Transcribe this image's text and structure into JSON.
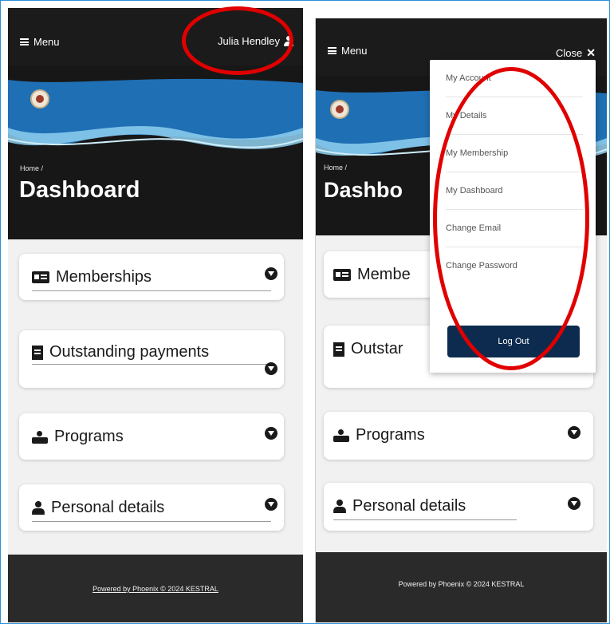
{
  "left_screen": {
    "menu_label": "Menu",
    "user_name": "Julia Hendley",
    "breadcrumb": "Home  /",
    "page_title": "Dashboard",
    "cards": [
      {
        "label": "Memberships",
        "icon": "id-card-icon"
      },
      {
        "label": "Outstanding payments",
        "icon": "receipt-icon"
      },
      {
        "label": "Programs",
        "icon": "people-icon"
      },
      {
        "label": "Personal details",
        "icon": "person-icon"
      }
    ],
    "footer": "Powered by Phoenix © 2024 KESTRAL"
  },
  "right_screen": {
    "menu_label": "Menu",
    "close_label": "Close",
    "breadcrumb": "Home  /",
    "page_title": "Dashbo",
    "cards": [
      {
        "label": "Membe"
      },
      {
        "label": "Outstar"
      },
      {
        "label": "Programs"
      },
      {
        "label": "Personal details"
      }
    ],
    "dropdown": {
      "items": [
        "My Account",
        "My Details",
        "My Membership",
        "My Dashboard",
        "Change Email",
        "Change Password"
      ],
      "logout_label": "Log Out"
    },
    "footer": "Powered by Phoenix © 2024 KESTRAL"
  },
  "colors": {
    "annotation": "#e00000",
    "header_bg": "#1b1b1b",
    "logout_bg": "#0d2b4e",
    "wave_blue": "#1f6fb4"
  }
}
